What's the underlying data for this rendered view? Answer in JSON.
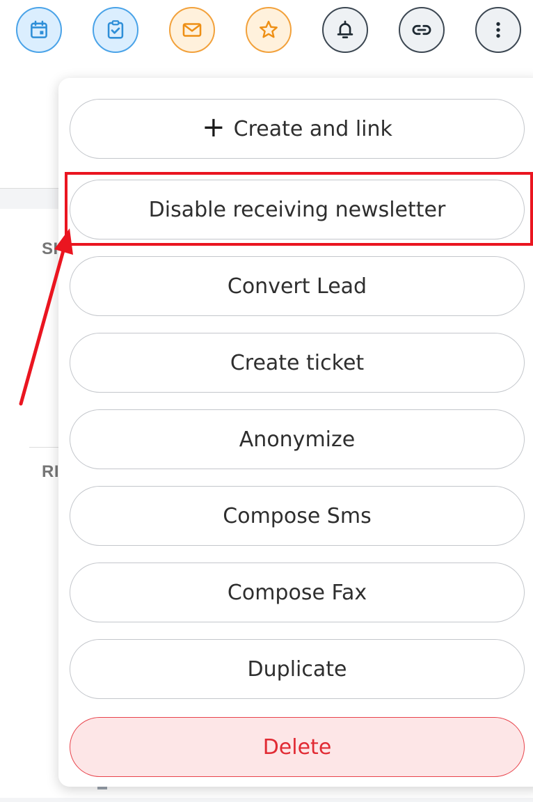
{
  "toolbar": {
    "icons": [
      {
        "name": "calendar-icon",
        "style": "blue"
      },
      {
        "name": "task-check-icon",
        "style": "blue"
      },
      {
        "name": "email-icon",
        "style": "orange"
      },
      {
        "name": "star-icon",
        "style": "orange"
      },
      {
        "name": "bell-icon",
        "style": "gray"
      },
      {
        "name": "link-icon",
        "style": "gray"
      },
      {
        "name": "more-vertical-icon",
        "style": "gray"
      }
    ]
  },
  "background": {
    "section_label_1": "SI",
    "section_label_2": "RI"
  },
  "menu": {
    "create_and_link": "Create and link",
    "disable_newsletter": "Disable receiving newsletter",
    "convert_lead": "Convert Lead",
    "create_ticket": "Create ticket",
    "anonymize": "Anonymize",
    "compose_sms": "Compose Sms",
    "compose_fax": "Compose Fax",
    "duplicate": "Duplicate",
    "delete": "Delete"
  },
  "colors": {
    "blue_accent": "#4aa3e8",
    "orange_accent": "#f2a13b",
    "gray_accent": "#3c4752",
    "danger": "#e12b34",
    "annotation_red": "#ea1520"
  }
}
